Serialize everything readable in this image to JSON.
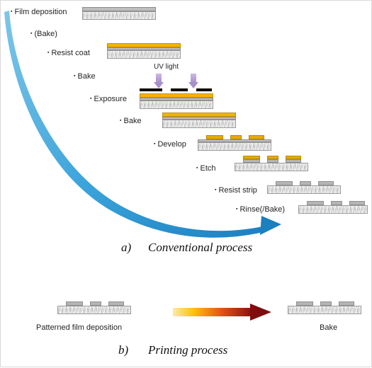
{
  "figure": {
    "part_a": {
      "caption_label": "a)",
      "caption_text": "Conventional process",
      "uv_label": "UV light",
      "steps": [
        {
          "id": "film-deposition",
          "label": "Film deposition"
        },
        {
          "id": "bake-1",
          "label": "(Bake)"
        },
        {
          "id": "resist-coat",
          "label": "Resist coat"
        },
        {
          "id": "bake-2",
          "label": "Bake"
        },
        {
          "id": "exposure",
          "label": "Exposure"
        },
        {
          "id": "bake-3",
          "label": "Bake"
        },
        {
          "id": "develop",
          "label": "Develop"
        },
        {
          "id": "etch",
          "label": "Etch"
        },
        {
          "id": "resist-strip",
          "label": "Resist strip"
        },
        {
          "id": "rinse-bake",
          "label": "Rinse(/Bake)"
        }
      ]
    },
    "part_b": {
      "caption_label": "b)",
      "caption_text": "Printing process",
      "left_label": "Patterned film deposition",
      "right_label": "Bake"
    }
  },
  "colors": {
    "resist_yellow": "#f2b400",
    "film_grey": "#bfbfbf",
    "mask_black": "#000000",
    "curve_blue": "#2f9fd8",
    "uv_arrow_purple": "#b9a3d6",
    "heat_arrow_from": "#ffe066",
    "heat_arrow_to": "#8b0f0f",
    "substrate_grey": "#d7d7d7"
  }
}
